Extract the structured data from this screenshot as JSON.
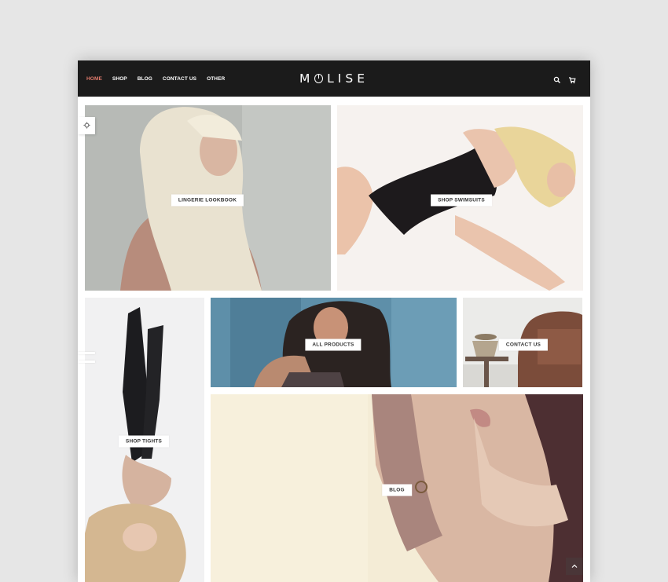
{
  "nav": {
    "items": [
      "HOME",
      "SHOP",
      "BLOG",
      "CONTACT US",
      "OTHER"
    ],
    "active_item": "HOME"
  },
  "logo": {
    "text_left": "M",
    "text_right": "LISE"
  },
  "header_icons": [
    "search-icon",
    "cart-icon"
  ],
  "tiles": {
    "lingerie": "LINGERIE LOOKBOOK",
    "swimsuits": "SHOP SWIMSUITS",
    "tights": "SHOP TIGHTS",
    "products": "ALL PRODUCTS",
    "contact": "CONTACT US",
    "blog": "BLOG"
  },
  "side_icons": [
    "gear-icon",
    "menu-icon",
    "chevron-up-icon"
  ],
  "colors": {
    "topbar": "#1b1b1b",
    "active_nav": "#e07a6c",
    "page_background": "#e6e6e6"
  }
}
